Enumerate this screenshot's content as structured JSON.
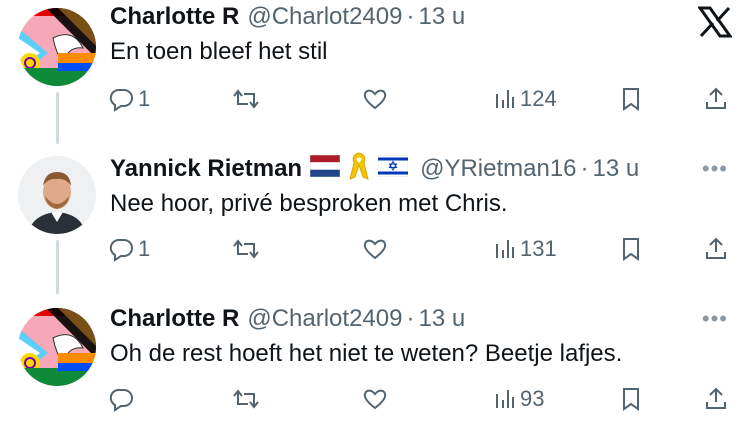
{
  "tweets": [
    {
      "name": "Charlotte R",
      "handle": "@Charlot2409",
      "separator": "·",
      "time": "13 u",
      "text": "En toen bleef het stil",
      "replies": "1",
      "retweets": "",
      "likes": "",
      "views": "124",
      "corner_icon": "x-logo-icon"
    },
    {
      "name": "Yannick Rietman",
      "handle": "@YRietman16",
      "separator": "·",
      "time": "13 u",
      "text": "Nee hoor, privé besproken met Chris.",
      "replies": "1",
      "retweets": "",
      "likes": "",
      "views": "131",
      "name_emoji": [
        "netherlands-flag-icon",
        "yellow-ribbon-icon",
        "israel-flag-icon"
      ],
      "more": "•••"
    },
    {
      "name": "Charlotte R",
      "handle": "@Charlot2409",
      "separator": "·",
      "time": "13 u",
      "text": "Oh de rest hoeft het niet te weten? Beetje lafjes.",
      "replies": "",
      "retweets": "",
      "likes": "",
      "views": "93",
      "more": "•••"
    }
  ],
  "colors": {
    "text": "#0f1419",
    "muted": "#536471",
    "thread_line": "#cfd9de"
  }
}
